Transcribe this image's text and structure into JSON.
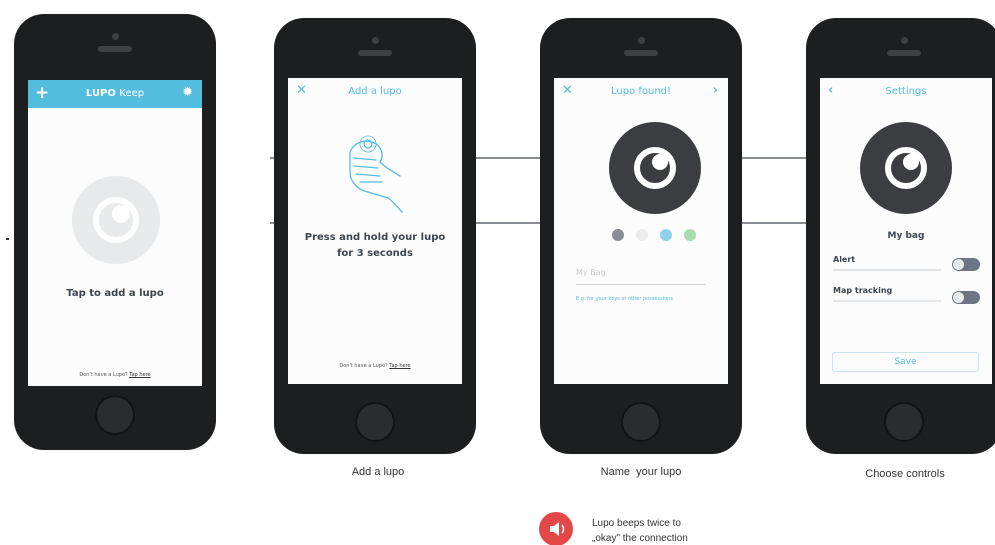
{
  "screens": {
    "home": {
      "app_title_bold": "LUPO",
      "app_title_light": "Keep",
      "add_icon": "plus-icon",
      "settings_icon": "gear-icon",
      "tap_text": "Tap to add a lupo",
      "footer_question": "Don't have a Lupo?",
      "footer_link": "Tap here"
    },
    "add": {
      "close_icon": "close-icon",
      "title": "Add a lupo",
      "illustration": "hand-press-icon",
      "instruction_line1": "Press and hold your lupo",
      "instruction_line2": "for 3 seconds",
      "footer_question": "Don't have a Lupo?",
      "footer_link": "Tap here"
    },
    "found": {
      "close_icon": "close-icon",
      "title": "Lupo found!",
      "next_icon": "chevron-right-icon",
      "color_options": [
        "#8a8d91",
        "#ececec",
        "#8fd1ea",
        "#a9dab0"
      ],
      "name_placeholder": "My Bag",
      "hint": "E.g. for your keys or other possessions"
    },
    "settings": {
      "back_icon": "chevron-left-icon",
      "title": "Settings",
      "device_name": "My bag",
      "alert_label": "Alert",
      "map_label": "Map tracking",
      "save_label": "Save"
    }
  },
  "captions": {
    "add": "Add a lupo",
    "name": "Name  your lupo",
    "controls": "Choose controls"
  },
  "note": {
    "icon": "speaker-icon",
    "line1": "Lupo beeps twice to",
    "line2": "„okay\" the connection"
  },
  "colors": {
    "accent": "#53bde0",
    "phone_body": "#1d1e20",
    "device_circle": "#3c3d40",
    "note_red": "#e24848"
  }
}
